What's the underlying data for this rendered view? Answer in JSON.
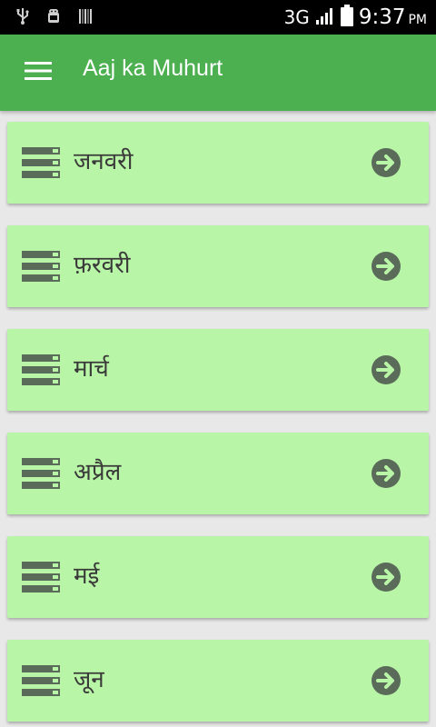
{
  "status_bar": {
    "icons_left": [
      "usb-icon",
      "android-debug-icon",
      "barcode-icon"
    ],
    "network": "3G",
    "signal_icon": "signal-icon",
    "battery_icon": "battery-icon",
    "time": "9:37",
    "ampm": "PM"
  },
  "app_bar": {
    "menu_icon": "hamburger-menu-icon",
    "title": "Aaj ka Muhurt",
    "color": "#4caf50"
  },
  "months": [
    {
      "label": "जनवरी"
    },
    {
      "label": "फ़रवरी"
    },
    {
      "label": "मार्च"
    },
    {
      "label": "अप्रैल"
    },
    {
      "label": "मई"
    },
    {
      "label": "जून"
    }
  ],
  "colors": {
    "card_background": "#b9f5a6",
    "icon_color": "#5a6b5a",
    "page_background": "#e8e8e8"
  }
}
